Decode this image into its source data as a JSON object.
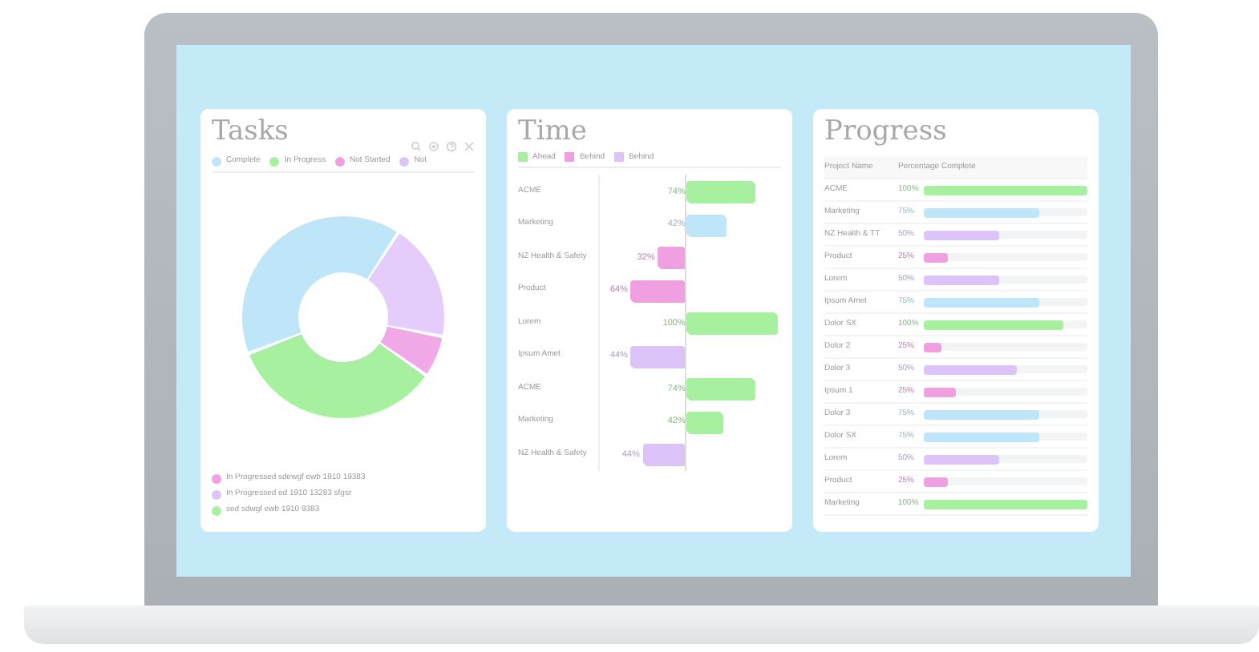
{
  "tasks": {
    "title": "Tasks",
    "legend": [
      {
        "label": "Complete",
        "color": "#bfe6f8"
      },
      {
        "label": "In Progress",
        "color": "#a6f0a0"
      },
      {
        "label": "Not Started",
        "color": "#f0a0e0"
      },
      {
        "label": "Not",
        "color": "#dcc4f8"
      }
    ],
    "notes": [
      {
        "text": "In Progressed sdewgf ewb 1910 19383",
        "color": "#f0a0e0"
      },
      {
        "text": "In Progressed ed 1910 13283 sfgsr",
        "color": "#dcc4f8"
      },
      {
        "text": "sed sdwgf ewb 1910 9383",
        "color": "#a6f0a0"
      }
    ]
  },
  "time": {
    "title": "Time",
    "legend": [
      {
        "label": "Ahead",
        "color": "#a6f0a0"
      },
      {
        "label": "Behind",
        "color": "#f0a0e0"
      },
      {
        "label": "Behind",
        "color": "#dcc4f8"
      }
    ],
    "rows": [
      {
        "label": "ACME",
        "reading": "74%",
        "level": 0.74,
        "kind": "ahead",
        "color": "#a6f0a0"
      },
      {
        "label": "Marketing",
        "reading": "42%",
        "level": 0.42,
        "kind": "ahead",
        "color": "#bfe6f8"
      },
      {
        "label": "NZ Health & Safety",
        "reading": "32%",
        "level": 0.32,
        "kind": "behind",
        "color": "#f0a0e0"
      },
      {
        "label": "Product",
        "reading": "64%",
        "level": 0.64,
        "kind": "behind",
        "color": "#f0a0e0"
      },
      {
        "label": "Lorem",
        "reading": "100%",
        "level": 1,
        "kind": "ahead",
        "color": "#a6f0a0"
      },
      {
        "label": "Ipsum Amet",
        "reading": "44%",
        "level": 0.64,
        "kind": "behind",
        "color": "#dcc4f8"
      },
      {
        "label": "ACME",
        "reading": "74%",
        "level": 0.74,
        "kind": "ahead",
        "color": "#a6f0a0"
      },
      {
        "label": "Marketing",
        "reading": "42%",
        "level": 0.38,
        "kind": "ahead",
        "color": "#a6f0a0"
      },
      {
        "label": "NZ Health & Safety",
        "reading": "44%",
        "level": 0.5,
        "kind": "behind",
        "color": "#dcc4f8"
      }
    ]
  },
  "progress": {
    "title": "Progress",
    "columns": [
      "Project Name",
      "Percentage Complete"
    ],
    "rows": [
      {
        "label": "ACME",
        "reading": "100%",
        "level": 1,
        "color": "#a6f0a0"
      },
      {
        "label": "Marketing",
        "reading": "75%",
        "level": 0.71,
        "color": "#bfe6f8"
      },
      {
        "label": "NZ Health & TT",
        "reading": "50%",
        "level": 0.46,
        "color": "#dcc4f8"
      },
      {
        "label": "Product",
        "reading": "25%",
        "level": 0.15,
        "color": "#f0a0e0"
      },
      {
        "label": "Lorem",
        "reading": "50%",
        "level": 0.46,
        "color": "#dcc4f8"
      },
      {
        "label": "Ipsum Amet",
        "reading": "75%",
        "level": 0.71,
        "color": "#bfe6f8"
      },
      {
        "label": "Dolor SX",
        "reading": "100%",
        "level": 0.85,
        "color": "#a6f0a0"
      },
      {
        "label": "Dolor 2",
        "reading": "25%",
        "level": 0.11,
        "color": "#f0a0e0"
      },
      {
        "label": "Dolor 3",
        "reading": "50%",
        "level": 0.57,
        "color": "#dcc4f8"
      },
      {
        "label": "Ipsum 1",
        "reading": "25%",
        "level": 0.2,
        "color": "#f0a0e0"
      },
      {
        "label": "Dolor 3",
        "reading": "75%",
        "level": 0.71,
        "color": "#bfe6f8"
      },
      {
        "label": "Dolor SX",
        "reading": "75%",
        "level": 0.71,
        "color": "#bfe6f8"
      },
      {
        "label": "Lorem",
        "reading": "50%",
        "level": 0.46,
        "color": "#dcc4f8"
      },
      {
        "label": "Product",
        "reading": "25%",
        "level": 0.15,
        "color": "#f0a0e0"
      },
      {
        "label": "Marketing",
        "reading": "100%",
        "level": 1,
        "color": "#a6f0a0"
      }
    ]
  }
}
